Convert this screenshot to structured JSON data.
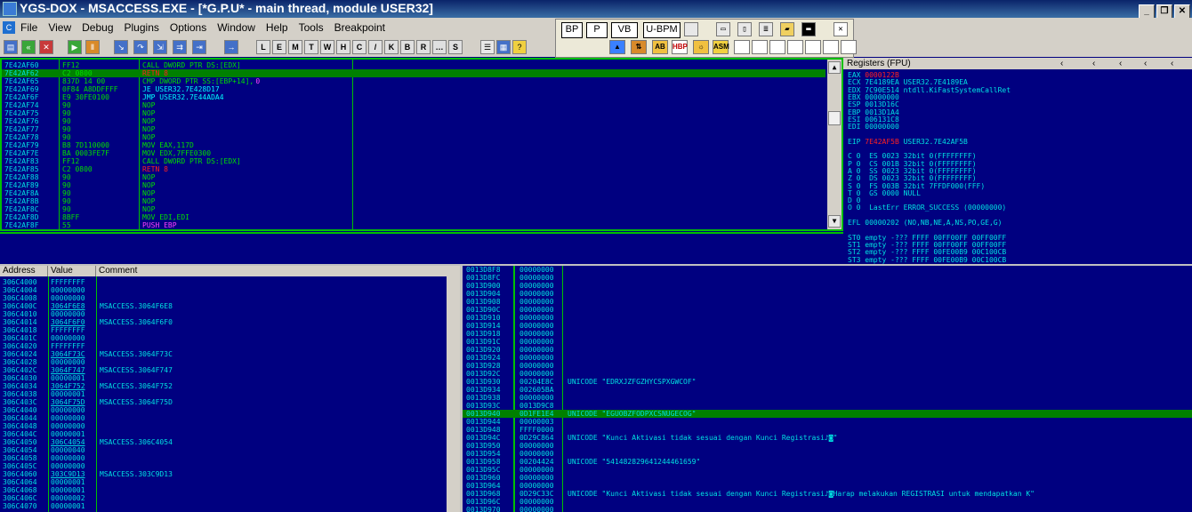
{
  "window": {
    "title": "YGS-DOX - MSACCESS.EXE - [*G.P.U* - main thread, module USER32]"
  },
  "menu": [
    "File",
    "View",
    "Debug",
    "Plugins",
    "Options",
    "Window",
    "Help",
    "Tools",
    "Breakpoint"
  ],
  "gpu": {
    "buttons": [
      "BP",
      "P",
      "VB",
      "U-BPM"
    ]
  },
  "cpu_rows": [
    {
      "addr": "7E42AF60",
      "hex": "FF12",
      "asm": "CALL DWORD PTR DS:[EDX]",
      "style": "normal"
    },
    {
      "addr": "7E42AF62",
      "hex": "C2 0800",
      "asm": "RETN 8",
      "style": "sel"
    },
    {
      "addr": "7E42AF65",
      "hex": "837D 14 00",
      "asm": "CMP DWORD PTR SS:[EBP+14],",
      "asm2": "0",
      "style": "normal"
    },
    {
      "addr": "7E42AF69",
      "hex": "0F84 A8DDFFFF",
      "asm": "JE USER32.7E428D17",
      "style": "cyan"
    },
    {
      "addr": "7E42AF6F",
      "hex": "E9 30FE0100",
      "asm": "JMP USER32.7E44ADA4",
      "style": "cyan"
    },
    {
      "addr": "7E42AF74",
      "hex": "90",
      "asm": "NOP",
      "style": "normal"
    },
    {
      "addr": "7E42AF75",
      "hex": "90",
      "asm": "NOP",
      "style": "normal"
    },
    {
      "addr": "7E42AF76",
      "hex": "90",
      "asm": "NOP",
      "style": "normal"
    },
    {
      "addr": "7E42AF77",
      "hex": "90",
      "asm": "NOP",
      "style": "normal"
    },
    {
      "addr": "7E42AF78",
      "hex": "90",
      "asm": "NOP",
      "style": "normal"
    },
    {
      "addr": "7E42AF79",
      "hex": "B8 7D110000",
      "asm": "MOV EAX,117D",
      "style": "normal"
    },
    {
      "addr": "7E42AF7E",
      "hex": "BA 0003FE7F",
      "asm": "MOV EDX,7FFE0300",
      "style": "normal"
    },
    {
      "addr": "7E42AF83",
      "hex": "FF12",
      "asm": "CALL DWORD PTR DS:[EDX]",
      "style": "normal"
    },
    {
      "addr": "7E42AF85",
      "hex": "C2 0800",
      "asm": "RETN 8",
      "style": "red"
    },
    {
      "addr": "7E42AF88",
      "hex": "90",
      "asm": "NOP",
      "style": "normal"
    },
    {
      "addr": "7E42AF89",
      "hex": "90",
      "asm": "NOP",
      "style": "normal"
    },
    {
      "addr": "7E42AF8A",
      "hex": "90",
      "asm": "NOP",
      "style": "normal"
    },
    {
      "addr": "7E42AF8B",
      "hex": "90",
      "asm": "NOP",
      "style": "normal"
    },
    {
      "addr": "7E42AF8C",
      "hex": "90",
      "asm": "NOP",
      "style": "normal"
    },
    {
      "addr": "7E42AF8D",
      "hex": "8BFF",
      "asm": "MOV EDI,EDI",
      "style": "normal"
    },
    {
      "addr": "7E42AF8F",
      "hex": "55",
      "asm": "PUSH EBP",
      "style": "mag"
    }
  ],
  "registers": {
    "title": "Registers (FPU)",
    "rows": [
      {
        "t": "EAX ",
        "v": "0000122B",
        "r": "",
        "vc": "red"
      },
      {
        "t": "ECX ",
        "v": "7E4189EA",
        "r": " USER32.7E4189EA",
        "vc": ""
      },
      {
        "t": "EDX ",
        "v": "7C90E514",
        "r": " ntdll.KiFastSystemCallRet",
        "vc": ""
      },
      {
        "t": "EBX ",
        "v": "00000000",
        "r": "",
        "vc": ""
      },
      {
        "t": "ESP ",
        "v": "0013D16C",
        "r": "",
        "vc": ""
      },
      {
        "t": "EBP ",
        "v": "0013D1A4",
        "r": "",
        "vc": ""
      },
      {
        "t": "ESI ",
        "v": "006131C8",
        "r": "",
        "vc": ""
      },
      {
        "t": "EDI ",
        "v": "00000000",
        "r": "",
        "vc": ""
      },
      {
        "t": "",
        "v": "",
        "r": "",
        "vc": ""
      },
      {
        "t": "EIP ",
        "v": "7E42AF5B",
        "r": " USER32.7E42AF5B",
        "vc": "red"
      },
      {
        "t": "",
        "v": "",
        "r": "",
        "vc": ""
      },
      {
        "t": "C 0  ",
        "v": "ES 0023 32bit 0(FFFFFFFF)",
        "r": "",
        "vc": ""
      },
      {
        "t": "P 0  ",
        "v": "CS 001B 32bit 0(FFFFFFFF)",
        "r": "",
        "vc": ""
      },
      {
        "t": "A 0  ",
        "v": "SS 0023 32bit 0(FFFFFFFF)",
        "r": "",
        "vc": ""
      },
      {
        "t": "Z 0  ",
        "v": "DS 0023 32bit 0(FFFFFFFF)",
        "r": "",
        "vc": ""
      },
      {
        "t": "S 0  ",
        "v": "FS 003B 32bit 7FFDF000(FFF)",
        "r": "",
        "vc": ""
      },
      {
        "t": "T 0  ",
        "v": "GS 0000 NULL",
        "r": "",
        "vc": ""
      },
      {
        "t": "D 0",
        "v": "",
        "r": "",
        "vc": ""
      },
      {
        "t": "O 0  ",
        "v": "LastErr ERROR_SUCCESS (00000000)",
        "r": "",
        "vc": ""
      },
      {
        "t": "",
        "v": "",
        "r": "",
        "vc": ""
      },
      {
        "t": "EFL ",
        "v": "00000202 (NO,NB,NE,A,NS,PO,GE,G)",
        "r": "",
        "vc": ""
      },
      {
        "t": "",
        "v": "",
        "r": "",
        "vc": ""
      },
      {
        "t": "ST0 ",
        "v": "empty -??? FFFF 00FF00FF 00FF00FF",
        "r": "",
        "vc": ""
      },
      {
        "t": "ST1 ",
        "v": "empty -??? FFFF 00FF00FF 00FF00FF",
        "r": "",
        "vc": ""
      },
      {
        "t": "ST2 ",
        "v": "empty -??? FFFF 00FE00B9 00C100CB",
        "r": "",
        "vc": ""
      },
      {
        "t": "ST3 ",
        "v": "empty -??? FFFF 00FE00B9 00C100CB",
        "r": "",
        "vc": ""
      }
    ]
  },
  "dump": {
    "headers": [
      "Address",
      "Value",
      "Comment"
    ],
    "rows": [
      {
        "a": "306C4000",
        "v": "FFFFFFFF",
        "c": "",
        "ul": false
      },
      {
        "a": "306C4004",
        "v": "00000000",
        "c": "",
        "ul": false
      },
      {
        "a": "306C4008",
        "v": "00000000",
        "c": "",
        "ul": false
      },
      {
        "a": "306C400C",
        "v": "3064F6E8",
        "c": "MSACCESS.3064F6E8",
        "ul": true
      },
      {
        "a": "306C4010",
        "v": "00000000",
        "c": "",
        "ul": false
      },
      {
        "a": "306C4014",
        "v": "3064F6F0",
        "c": "MSACCESS.3064F6F0",
        "ul": true
      },
      {
        "a": "306C4018",
        "v": "FFFFFFFF",
        "c": "",
        "ul": false
      },
      {
        "a": "306C401C",
        "v": "00000000",
        "c": "",
        "ul": false
      },
      {
        "a": "306C4020",
        "v": "FFFFFFFF",
        "c": "",
        "ul": false
      },
      {
        "a": "306C4024",
        "v": "3064F73C",
        "c": "MSACCESS.3064F73C",
        "ul": true
      },
      {
        "a": "306C4028",
        "v": "00000000",
        "c": "",
        "ul": false
      },
      {
        "a": "306C402C",
        "v": "3064F747",
        "c": "MSACCESS.3064F747",
        "ul": true
      },
      {
        "a": "306C4030",
        "v": "00000001",
        "c": "",
        "ul": false
      },
      {
        "a": "306C4034",
        "v": "3064F752",
        "c": "MSACCESS.3064F752",
        "ul": true
      },
      {
        "a": "306C4038",
        "v": "00000001",
        "c": "",
        "ul": false
      },
      {
        "a": "306C403C",
        "v": "3064F75D",
        "c": "MSACCESS.3064F75D",
        "ul": true
      },
      {
        "a": "306C4040",
        "v": "00000000",
        "c": "",
        "ul": false
      },
      {
        "a": "306C4044",
        "v": "00000000",
        "c": "",
        "ul": false
      },
      {
        "a": "306C4048",
        "v": "00000000",
        "c": "",
        "ul": false
      },
      {
        "a": "306C404C",
        "v": "00000001",
        "c": "",
        "ul": false
      },
      {
        "a": "306C4050",
        "v": "306C4054",
        "c": "MSACCESS.306C4054",
        "ul": true
      },
      {
        "a": "306C4054",
        "v": "00000040",
        "c": "",
        "ul": false
      },
      {
        "a": "306C4058",
        "v": "00000000",
        "c": "",
        "ul": false
      },
      {
        "a": "306C405C",
        "v": "00000000",
        "c": "",
        "ul": false
      },
      {
        "a": "306C4060",
        "v": "303C9D13",
        "c": "MSACCESS.303C9D13",
        "ul": true
      },
      {
        "a": "306C4064",
        "v": "00000001",
        "c": "",
        "ul": false
      },
      {
        "a": "306C4068",
        "v": "00000001",
        "c": "",
        "ul": false
      },
      {
        "a": "306C406C",
        "v": "00000002",
        "c": "",
        "ul": false
      },
      {
        "a": "306C4070",
        "v": "00000001",
        "c": "",
        "ul": false
      }
    ]
  },
  "stack": {
    "rows": [
      {
        "a": "0013D8F8",
        "v": "00000000",
        "c": ""
      },
      {
        "a": "0013D8FC",
        "v": "00000000",
        "c": ""
      },
      {
        "a": "0013D900",
        "v": "00000000",
        "c": ""
      },
      {
        "a": "0013D904",
        "v": "00000000",
        "c": ""
      },
      {
        "a": "0013D908",
        "v": "00000000",
        "c": ""
      },
      {
        "a": "0013D90C",
        "v": "00000000",
        "c": ""
      },
      {
        "a": "0013D910",
        "v": "00000000",
        "c": ""
      },
      {
        "a": "0013D914",
        "v": "00000000",
        "c": ""
      },
      {
        "a": "0013D918",
        "v": "00000000",
        "c": ""
      },
      {
        "a": "0013D91C",
        "v": "00000000",
        "c": ""
      },
      {
        "a": "0013D920",
        "v": "00000000",
        "c": ""
      },
      {
        "a": "0013D924",
        "v": "00000000",
        "c": ""
      },
      {
        "a": "0013D928",
        "v": "00000000",
        "c": ""
      },
      {
        "a": "0013D92C",
        "v": "00000000",
        "c": ""
      },
      {
        "a": "0013D930",
        "v": "00204E8C",
        "c": "UNICODE \"EDRXJZFGZHYCSPXGWCOF\""
      },
      {
        "a": "0013D934",
        "v": "002605BA",
        "c": ""
      },
      {
        "a": "0013D938",
        "v": "00000000",
        "c": ""
      },
      {
        "a": "0013D93C",
        "v": "0013D9C8",
        "c": ""
      },
      {
        "a": "0013D940",
        "v": "0D1FE1E4",
        "c": "UNICODE \"EGUOBZFODPXCSNUGECOG\"",
        "sel": true
      },
      {
        "a": "0013D944",
        "v": "00000003",
        "c": ""
      },
      {
        "a": "0013D948",
        "v": "FFFF0000",
        "c": ""
      },
      {
        "a": "0013D94C",
        "v": "0D29C864",
        "c": "UNICODE \"Kunci Aktivasi tidak sesuai dengan Kunci Registrasi♪◙\""
      },
      {
        "a": "0013D950",
        "v": "00000000",
        "c": ""
      },
      {
        "a": "0013D954",
        "v": "00000000",
        "c": ""
      },
      {
        "a": "0013D958",
        "v": "00204424",
        "c": "UNICODE \"541482829641244461659\""
      },
      {
        "a": "0013D95C",
        "v": "00000000",
        "c": ""
      },
      {
        "a": "0013D960",
        "v": "00000000",
        "c": ""
      },
      {
        "a": "0013D964",
        "v": "00000000",
        "c": ""
      },
      {
        "a": "0013D968",
        "v": "0D29C33C",
        "c": "UNICODE \"Kunci Aktivasi tidak sesuai dengan Kunci Registrasi♪◙Harap melakukan REGISTRASI untuk mendapatkan K\""
      },
      {
        "a": "0013D96C",
        "v": "00000000",
        "c": ""
      },
      {
        "a": "0013D970",
        "v": "00000000",
        "c": ""
      }
    ]
  }
}
